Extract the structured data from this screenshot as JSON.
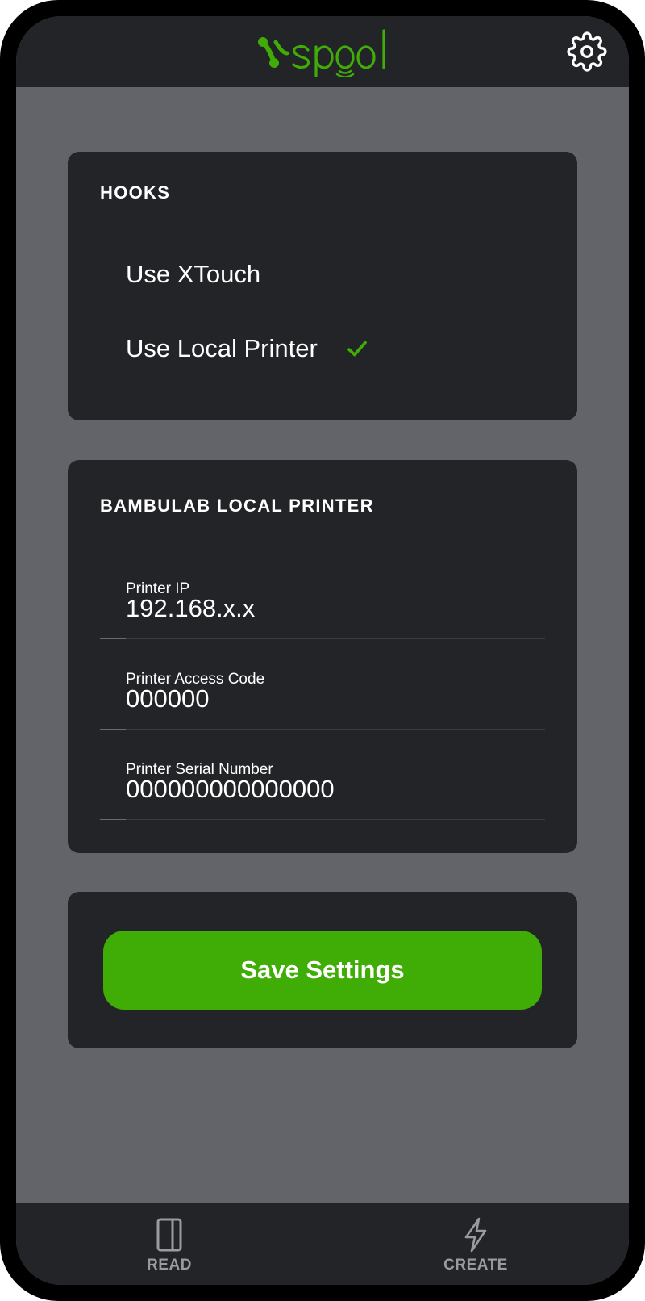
{
  "app": {
    "logo_text": "spool",
    "brand_color": "#3fad06",
    "header_icon": "gear-icon"
  },
  "hooks": {
    "title": "HOOKS",
    "items": [
      {
        "label": "Use XTouch",
        "checked": false
      },
      {
        "label": "Use Local Printer",
        "checked": true,
        "icon": "check-icon"
      }
    ]
  },
  "printer": {
    "title": "BAMBULAB LOCAL PRINTER",
    "fields": [
      {
        "label": "Printer IP",
        "value": "192.168.x.x"
      },
      {
        "label": "Printer Access Code",
        "value": "000000"
      },
      {
        "label": "Printer Serial Number",
        "value": "000000000000000"
      }
    ]
  },
  "actions": {
    "save_label": "Save Settings"
  },
  "nav": {
    "items": [
      {
        "label": "READ",
        "icon": "book-icon"
      },
      {
        "label": "CREATE",
        "icon": "lightning-icon"
      }
    ]
  }
}
